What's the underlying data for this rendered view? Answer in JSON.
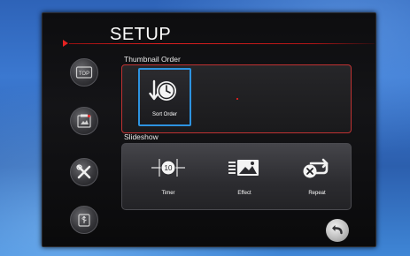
{
  "header": {
    "title": "SETUP"
  },
  "nav": {
    "items": [
      {
        "icon": "top-icon",
        "label": "TOP"
      },
      {
        "icon": "calendar-photo-icon"
      },
      {
        "icon": "tools-icon"
      },
      {
        "icon": "usb-icon"
      }
    ]
  },
  "thumbnail_order": {
    "label": "Thumbnail Order",
    "tiles": [
      {
        "label": "Sort Order",
        "icon": "sort-clock-icon",
        "selected": true
      }
    ]
  },
  "slideshow": {
    "label": "Slideshow",
    "items": [
      {
        "label": "Timer",
        "icon": "timer-icon",
        "timer_value": "10"
      },
      {
        "label": "Effect",
        "icon": "effect-icon"
      },
      {
        "label": "Repeat",
        "icon": "repeat-icon"
      }
    ]
  },
  "footer": {
    "back_icon": "back-arrow-icon"
  },
  "colors": {
    "accent_red": "#e02020",
    "selection_blue": "#2d93e0"
  }
}
